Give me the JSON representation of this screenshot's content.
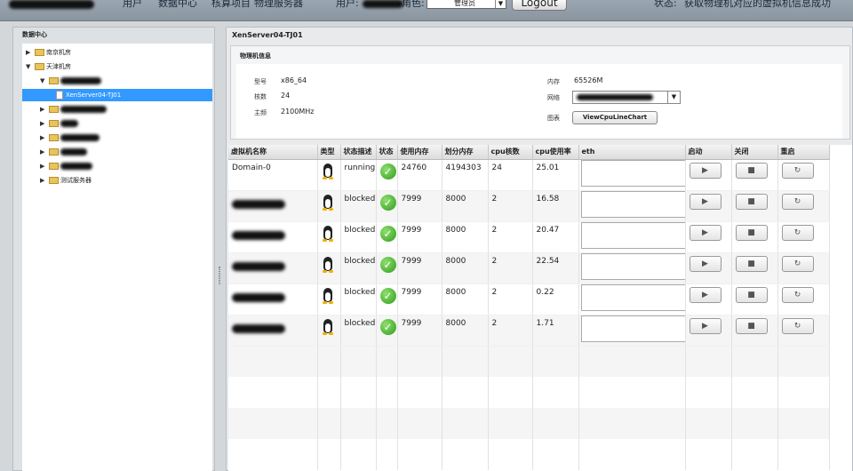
{
  "topbar": {
    "nav": [
      "用户",
      "数据中心",
      "核算项目",
      "物理服务器"
    ],
    "user_label": "用户:",
    "role_label": "角色:",
    "role_value": "管理员",
    "logout": "Logout",
    "status_label": "状态:",
    "status_text": "获取物理机对应的虚拟机信息成功"
  },
  "left": {
    "title": "数据中心",
    "tree": [
      {
        "label": "南京机房",
        "toggle": "▶",
        "type": "folder"
      },
      {
        "label": "天津机房",
        "toggle": "▼",
        "type": "folder"
      },
      {
        "label": "",
        "toggle": "▼",
        "type": "folder"
      },
      {
        "label": "XenServer04-TJ01",
        "toggle": "",
        "type": "file"
      },
      {
        "label": "",
        "toggle": "▶",
        "type": "folder"
      },
      {
        "label": "",
        "toggle": "▶",
        "type": "folder"
      },
      {
        "label": "",
        "toggle": "▶",
        "type": "folder"
      },
      {
        "label": "",
        "toggle": "▶",
        "type": "folder"
      },
      {
        "label": "",
        "toggle": "▶",
        "type": "folder"
      },
      {
        "label": "测试服务器",
        "toggle": "▶",
        "type": "folder"
      }
    ]
  },
  "right": {
    "title": "XenServer04-TJ01",
    "phys": {
      "title": "物理机信息",
      "model_label": "型号",
      "model_value": "x86_64",
      "cores_label": "核数",
      "cores_value": "24",
      "freq_label": "主频",
      "freq_value": "2100MHz",
      "mem_label": "内存",
      "mem_value": "65526M",
      "nic_label": "网络",
      "chart_label": "图表",
      "chart_button": "ViewCpuLineChart"
    }
  },
  "grid": {
    "headers": [
      "虚拟机名称",
      "类型",
      "状态描述",
      "状态",
      "使用内存",
      "划分内存",
      "cpu核数",
      "cpu使用率",
      "eth",
      "启动",
      "关闭",
      "重启"
    ],
    "rows": [
      {
        "name": "Domain-0",
        "status": "running",
        "used_mem": "24760",
        "alloc_mem": "4194303",
        "cpus": "24",
        "cpu_usage": "25.01"
      },
      {
        "name": "",
        "status": "blocked",
        "used_mem": "7999",
        "alloc_mem": "8000",
        "cpus": "2",
        "cpu_usage": "16.58"
      },
      {
        "name": "",
        "status": "blocked",
        "used_mem": "7999",
        "alloc_mem": "8000",
        "cpus": "2",
        "cpu_usage": "20.47"
      },
      {
        "name": "",
        "status": "blocked",
        "used_mem": "7999",
        "alloc_mem": "8000",
        "cpus": "2",
        "cpu_usage": "22.54"
      },
      {
        "name": "",
        "status": "blocked",
        "used_mem": "7999",
        "alloc_mem": "8000",
        "cpus": "2",
        "cpu_usage": "0.22"
      },
      {
        "name": "",
        "status": "blocked",
        "used_mem": "7999",
        "alloc_mem": "8000",
        "cpus": "2",
        "cpu_usage": "1.71"
      }
    ],
    "icons": {
      "type": "linux-penguin-icon",
      "state": "check-icon",
      "start": "play-icon",
      "stop": "stop-icon",
      "restart": "refresh-icon"
    }
  }
}
